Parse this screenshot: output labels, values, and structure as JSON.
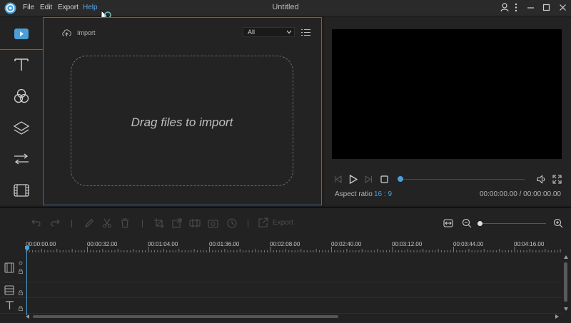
{
  "titlebar": {
    "app_title": "Untitled",
    "menu": [
      "File",
      "Edit",
      "Export",
      "Help"
    ]
  },
  "media": {
    "import_label": "Import",
    "filter_selected": "All",
    "dropzone_text": "Drag files to import"
  },
  "preview": {
    "aspect_ratio_label": "Aspect ratio",
    "aspect_ratio_value": "16 : 9",
    "time_display": "00:00:00.00 / 00:00:00.00"
  },
  "timeline": {
    "export_label": "Export",
    "ruler_labels": [
      "00:00:00.00",
      "00:00:32.00",
      "00:01:04.00",
      "00:01:36.00",
      "00:02:08.00",
      "00:02:40.00",
      "00:03:12.00",
      "00:03:44.00",
      "00:04:16.00"
    ]
  },
  "colors": {
    "accent": "#4a9fd8",
    "panel_border": "#3d6f9e"
  }
}
